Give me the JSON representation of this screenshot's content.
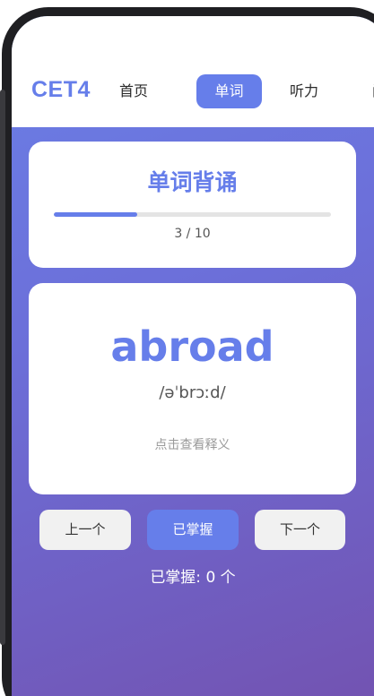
{
  "app": {
    "logo": "CET4"
  },
  "nav": {
    "home": "首页",
    "words": "单词",
    "listening": "听力",
    "reading": "阅"
  },
  "progress_card": {
    "title": "单词背诵",
    "progress_text": "3 / 10",
    "progress_fraction": 0.3
  },
  "word_card": {
    "word": "abroad",
    "phonetic": "/əˈbrɔːd/",
    "hint": "点击查看释义"
  },
  "buttons": {
    "prev": "上一个",
    "mastered": "已掌握",
    "next": "下一个"
  },
  "stats": {
    "mastered_count": "已掌握: 0 个"
  },
  "colors": {
    "accent": "#667eea",
    "gradient_end": "#764ba2"
  }
}
